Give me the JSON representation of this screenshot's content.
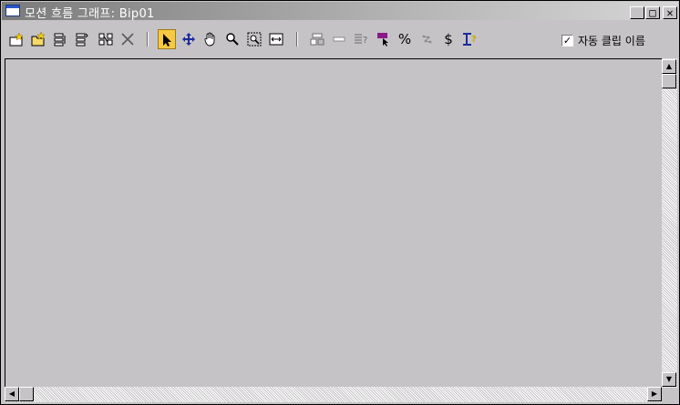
{
  "window": {
    "title": "모션 흐름 그래프: Bip01",
    "controls": {
      "minimize": "_",
      "maximize": "□",
      "close": "✕"
    }
  },
  "toolbar": {
    "tools": [
      {
        "name": "create-motion-clip-icon"
      },
      {
        "name": "load-file-icon"
      },
      {
        "name": "save-script-icon"
      },
      {
        "name": "load-script-icon"
      },
      {
        "name": "create-transition-icon"
      },
      {
        "name": "delete-icon"
      },
      {
        "name": "select-arrow-icon"
      },
      {
        "name": "move-icon"
      },
      {
        "name": "pan-hand-icon"
      },
      {
        "name": "zoom-icon"
      },
      {
        "name": "zoom-region-icon"
      },
      {
        "name": "zoom-extents-icon"
      },
      {
        "name": "show-all-icon"
      },
      {
        "name": "show-selected-icon"
      },
      {
        "name": "show-properties-icon"
      },
      {
        "name": "select-random-start-icon"
      },
      {
        "name": "percentage-icon"
      },
      {
        "name": "optimize-transitions-icon"
      },
      {
        "name": "currency-icon"
      },
      {
        "name": "transition-properties-icon"
      }
    ],
    "symbols": {
      "percent": "%",
      "dollar": "$"
    },
    "auto_clip_name": {
      "label": "자동 클립 이름",
      "checked_mark": "✓"
    }
  },
  "scrollbars": {
    "up_arrow": "▲",
    "down_arrow": "▼",
    "left_arrow": "◀",
    "right_arrow": "▶"
  }
}
